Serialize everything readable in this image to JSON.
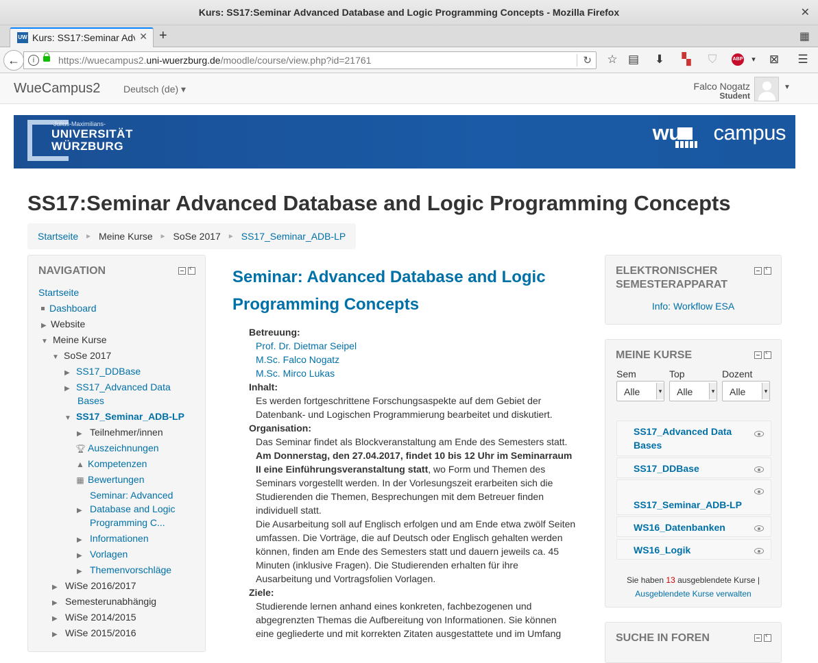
{
  "window": {
    "title": "Kurs: SS17:Seminar Advanced Database and Logic Programming Concepts - Mozilla Firefox",
    "close": "✕"
  },
  "tab": {
    "title": "Kurs: SS17:Seminar Adv",
    "favicon": "UW",
    "close": "✕",
    "new_tab": "+"
  },
  "url": {
    "prefix": "https://wuecampus2.",
    "domain": "uni-wuerzburg.de",
    "path": "/moodle/course/view.php?id=21761"
  },
  "toolbar_icons": [
    "star-icon",
    "reading-list-icon",
    "download-icon",
    "extension-icon",
    "shield-icon",
    "adblock-icon",
    "screenshot-icon",
    "menu-icon"
  ],
  "header": {
    "brand": "WueCampus2",
    "language": "Deutsch (de) ▾",
    "user_name": "Falco Nogatz",
    "user_role": "Student"
  },
  "banner": {
    "uni_small": "Julius-Maximilians-",
    "uni_line1": "UNIVERSITÄT",
    "uni_line2": "WÜRZBURG",
    "logo_a": "wue",
    "logo_b": "campus"
  },
  "page_title": "SS17:Seminar Advanced Database and Logic Programming Concepts",
  "breadcrumb": [
    "Startseite",
    "Meine Kurse",
    "SoSe 2017",
    "SS17_Seminar_ADB-LP"
  ],
  "navigation": {
    "title": "NAVIGATION",
    "items": {
      "startseite": "Startseite",
      "dashboard": "Dashboard",
      "website": "Website",
      "meine_kurse": "Meine Kurse",
      "sose2017": "SoSe 2017",
      "ddbase": "SS17_DDBase",
      "adb1": "SS17_Advanced Data",
      "adb2": "Bases",
      "seminar": "SS17_Seminar_ADB-LP",
      "teilnehmer": "Teilnehmer/innen",
      "auszeichnungen": "Auszeichnungen",
      "kompetenzen": "Kompetenzen",
      "bewertungen": "Bewertungen",
      "sem1": "Seminar: Advanced",
      "sem2": "Database and Logic",
      "sem3": "Programming C...",
      "informationen": "Informationen",
      "vorlagen": "Vorlagen",
      "themen": "Themenvorschläge",
      "wise1617": "WiSe 2016/2017",
      "semunab": "Semesterunabhängig",
      "wise1415": "WiSe 2014/2015",
      "wise1516": "WiSe 2015/2016"
    }
  },
  "section": {
    "title": "Seminar: Advanced Database and Logic Programming Concepts",
    "betreuung_label": "Betreuung:",
    "betreuer": [
      "Prof. Dr. Dietmar Seipel",
      "M.Sc. Falco Nogatz",
      "M.Sc. Mirco Lukas"
    ],
    "inhalt_label": "Inhalt:",
    "inhalt": "Es werden fortgeschrittene Forschungsaspekte auf dem Gebiet der Datenbank- und Logischen Programmierung bearbeitet und diskutiert.",
    "organisation_label": "Organisation:",
    "org_p1": "Das Seminar findet als Blockveranstaltung am Ende des Semesters statt.",
    "org_bold": "Am Donnerstag, den 27.04.2017, findet 10 bis 12 Uhr im Seminarraum II eine Einführungsveranstaltung statt",
    "org_p2": ", wo Form und Themen des Seminars vorgestellt werden. In der Vorlesungszeit erarbeiten sich die Studierenden die Themen, Besprechungen mit dem Betreuer finden individuell statt.",
    "org_p3": "Die Ausarbeitung soll auf Englisch erfolgen und am Ende etwa zwölf Seiten umfassen. Die Vorträge, die auf Deutsch oder Englisch gehalten werden können, finden am Ende des Semesters statt und dauern jeweils ca. 45 Minuten (inklusive Fragen). Die Studierenden erhalten für ihre Ausarbeitung und Vortragsfolien Vorlagen.",
    "ziele_label": "Ziele:",
    "ziele": "Studierende lernen anhand eines konkreten, fachbezogenen und abgegrenzten Themas die Aufbereitung von Informationen. Sie können eine gegliederte und mit korrekten Zitaten ausgestattete und im Umfang"
  },
  "esa": {
    "title": "ELEKTRONISCHER SEMESTERAPPARAT",
    "link": "Info: Workflow ESA"
  },
  "meine_kurse": {
    "title": "MEINE KURSE",
    "filters": [
      {
        "label": "Sem",
        "value": "Alle"
      },
      {
        "label": "Top",
        "value": "Alle"
      },
      {
        "label": "Dozent",
        "value": "Alle"
      }
    ],
    "courses": [
      "SS17_Advanced Data Bases",
      "SS17_DDBase",
      "SS17_Seminar_ADB-LP",
      "WS16_Datenbanken",
      "WS16_Logik"
    ],
    "hidden_prefix": "Sie haben ",
    "hidden_count": "13",
    "hidden_suffix": " ausgeblendete Kurse |",
    "manage_link": "Ausgeblendete Kurse verwalten"
  },
  "search_forums": {
    "title": "SUCHE IN FOREN"
  }
}
